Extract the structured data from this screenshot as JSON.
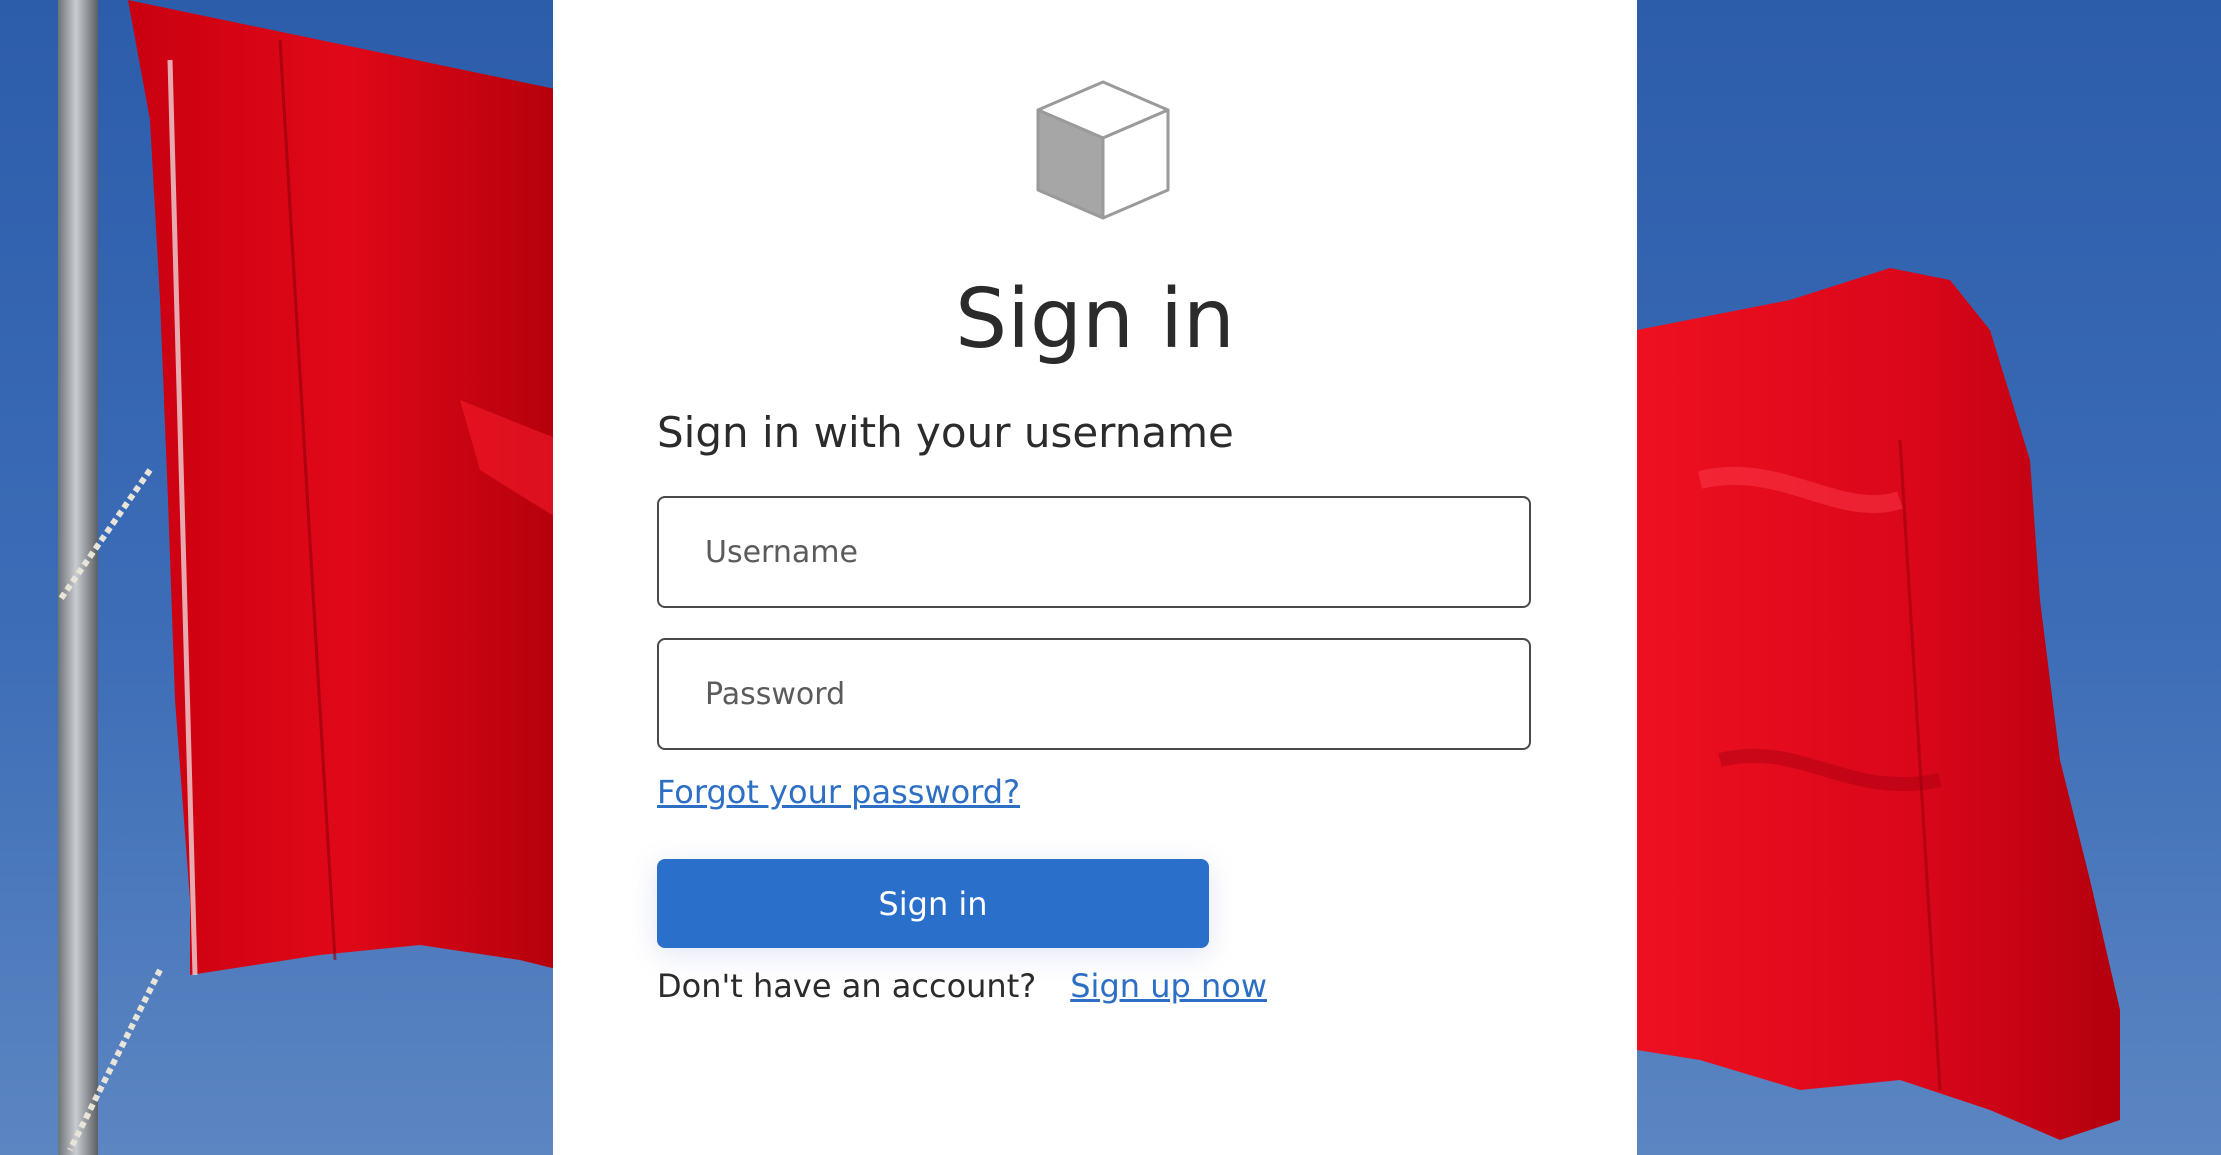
{
  "page": {
    "title": "Sign in",
    "subtitle": "Sign in with your username"
  },
  "form": {
    "username": {
      "placeholder": "Username",
      "value": ""
    },
    "password": {
      "placeholder": "Password",
      "value": ""
    },
    "forgot_password_link": "Forgot your password?",
    "submit_label": "Sign in",
    "no_account_text": "Don't have an account?",
    "signup_link": "Sign up now"
  },
  "branding": {
    "logo_icon": "cube-icon",
    "background_image": "red-flags-photo"
  },
  "colors": {
    "accent": "#2a6fca",
    "link": "#2c6fc4",
    "sky": "#3c6cb6",
    "flag": "#e3071a",
    "panel": "#ffffff",
    "text": "#2b2b2b"
  }
}
